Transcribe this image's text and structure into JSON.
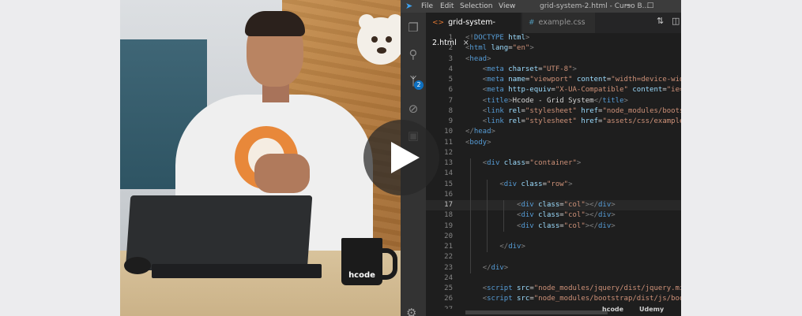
{
  "editor": {
    "menu": [
      "File",
      "Edit",
      "Selection",
      "View"
    ],
    "window_title": "grid-system-2.html - Curso B...",
    "tabs": [
      {
        "icon": "<>",
        "label": "grid-system-2.html",
        "close": "×",
        "active": true
      },
      {
        "icon": "#",
        "label": "example.css",
        "active": false
      }
    ],
    "scm_badge": "2",
    "current_line": 17,
    "lines": [
      {
        "n": "1",
        "text": "<!DOCTYPE html>"
      },
      {
        "n": "2",
        "text": "<html lang=\"en\">"
      },
      {
        "n": "3",
        "text": "<head>"
      },
      {
        "n": "4",
        "text": "    <meta charset=\"UTF-8\">"
      },
      {
        "n": "5",
        "text": "    <meta name=\"viewport\" content=\"width=device-wid"
      },
      {
        "n": "6",
        "text": "    <meta http-equiv=\"X-UA-Compatible\" content=\"ie="
      },
      {
        "n": "7",
        "text": "    <title>Hcode - Grid System</title>"
      },
      {
        "n": "8",
        "text": "    <link rel=\"stylesheet\" href=\"node_modules/boots"
      },
      {
        "n": "9",
        "text": "    <link rel=\"stylesheet\" href=\"assets/css/example"
      },
      {
        "n": "10",
        "text": "</head>"
      },
      {
        "n": "11",
        "text": "<body>"
      },
      {
        "n": "12",
        "text": ""
      },
      {
        "n": "13",
        "text": "    <div class=\"container\">"
      },
      {
        "n": "14",
        "text": ""
      },
      {
        "n": "15",
        "text": "        <div class=\"row\">"
      },
      {
        "n": "16",
        "text": ""
      },
      {
        "n": "17",
        "text": "            <div class=\"col\"></div>"
      },
      {
        "n": "18",
        "text": "            <div class=\"col\"></div>"
      },
      {
        "n": "19",
        "text": "            <div class=\"col\"></div>"
      },
      {
        "n": "20",
        "text": ""
      },
      {
        "n": "21",
        "text": "        </div>"
      },
      {
        "n": "22",
        "text": ""
      },
      {
        "n": "23",
        "text": "    </div>"
      },
      {
        "n": "24",
        "text": ""
      },
      {
        "n": "25",
        "text": "    <script src=\"node_modules/jquery/dist/jquery.mi"
      },
      {
        "n": "26",
        "text": "    <script src=\"node_modules/bootstrap/dist/js/boo"
      },
      {
        "n": "27",
        "text": ""
      }
    ]
  },
  "video": {
    "mug_text": "hcode",
    "watermarks": [
      "hcode",
      "Udemy"
    ]
  },
  "icons": {
    "explorer": "files-icon",
    "search": "search-icon",
    "scm": "source-control-icon",
    "debug": "debug-icon",
    "extensions": "extensions-icon",
    "settings": "gear-icon",
    "play": "play-icon"
  },
  "colors": {
    "editor_bg": "#1e1e1e",
    "tag": "#569cd6",
    "attr": "#9cdcfe",
    "string": "#ce9178",
    "text": "#d4d4d4"
  }
}
